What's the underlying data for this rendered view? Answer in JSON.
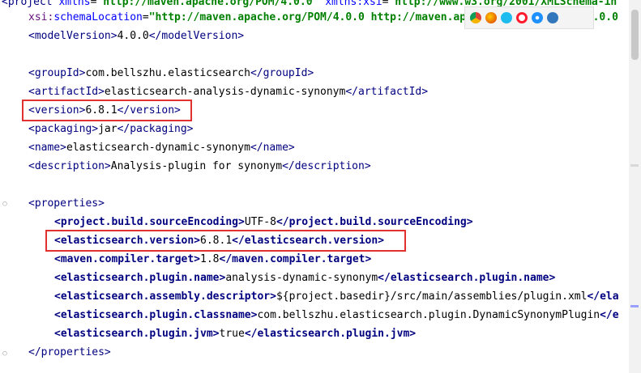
{
  "colors": {
    "tag": "#000080",
    "attribute": "#0000ff",
    "namespace": "#660e7a",
    "string": "#008000",
    "highlight": "#e03030"
  },
  "browser_icons": [
    "chrome-icon",
    "firefox-icon",
    "ie-icon",
    "opera-icon",
    "safari-icon",
    "edge-icon"
  ],
  "lines": {
    "l0": {
      "t1": "<project ",
      "a1": "xmlns",
      "eq1": "=",
      "v1": "\"http://maven.apache.org/POM/4.0.0\"",
      "sp": " ",
      "a2": "xmlns:xsi",
      "eq2": "=",
      "v2": "\"http://www.w3.org/2001/XMLSchema-in"
    },
    "l1": {
      "ns": "xsi:",
      "a": "schemaLocation",
      "eq": "=",
      "v": "\"http://maven.apache.org/POM/4.0.0 http://maven.apache.org/xsd/maven-4.0.0"
    },
    "l2": {
      "open": "<modelVersion>",
      "text": "4.0.0",
      "close": "</modelVersion>"
    },
    "l4": {
      "open": "<groupId>",
      "text": "com.bellszhu.elasticsearch",
      "close": "</groupId>"
    },
    "l5": {
      "open": "<artifactId>",
      "text": "elasticsearch-analysis-dynamic-synonym",
      "close": "</artifactId>"
    },
    "l6": {
      "open": "<version>",
      "text": "6.8.1",
      "close": "</version>"
    },
    "l7": {
      "open": "<packaging>",
      "text": "jar",
      "close": "</packaging>"
    },
    "l8": {
      "open": "<name>",
      "text": "elasticsearch-dynamic-synonym",
      "close": "</name>"
    },
    "l9": {
      "open": "<description>",
      "text": "Analysis-plugin for synonym",
      "close": "</description>"
    },
    "l11": {
      "open": "<properties>"
    },
    "l12": {
      "open": "<project.build.sourceEncoding>",
      "text": "UTF-8",
      "close": "</project.build.sourceEncoding>"
    },
    "l13": {
      "open": "<elasticsearch.version>",
      "text": "6.8.1",
      "close": "</elasticsearch.version>"
    },
    "l14": {
      "open": "<maven.compiler.target>",
      "text": "1.8",
      "close": "</maven.compiler.target>"
    },
    "l15": {
      "open": "<elasticsearch.plugin.name>",
      "text": "analysis-dynamic-synonym",
      "close": "</elasticsearch.plugin.name>"
    },
    "l16": {
      "open": "<elasticsearch.assembly.descriptor>",
      "text": "${project.basedir}/src/main/assemblies/plugin.xml",
      "close": "</ela"
    },
    "l17": {
      "open": "<elasticsearch.plugin.classname>",
      "text": "com.bellszhu.elasticsearch.plugin.DynamicSynonymPlugin",
      "close": "</e"
    },
    "l18": {
      "open": "<elasticsearch.plugin.jvm>",
      "text": "true",
      "close": "</elasticsearch.plugin.jvm>"
    },
    "l19": {
      "close": "</properties>"
    }
  }
}
